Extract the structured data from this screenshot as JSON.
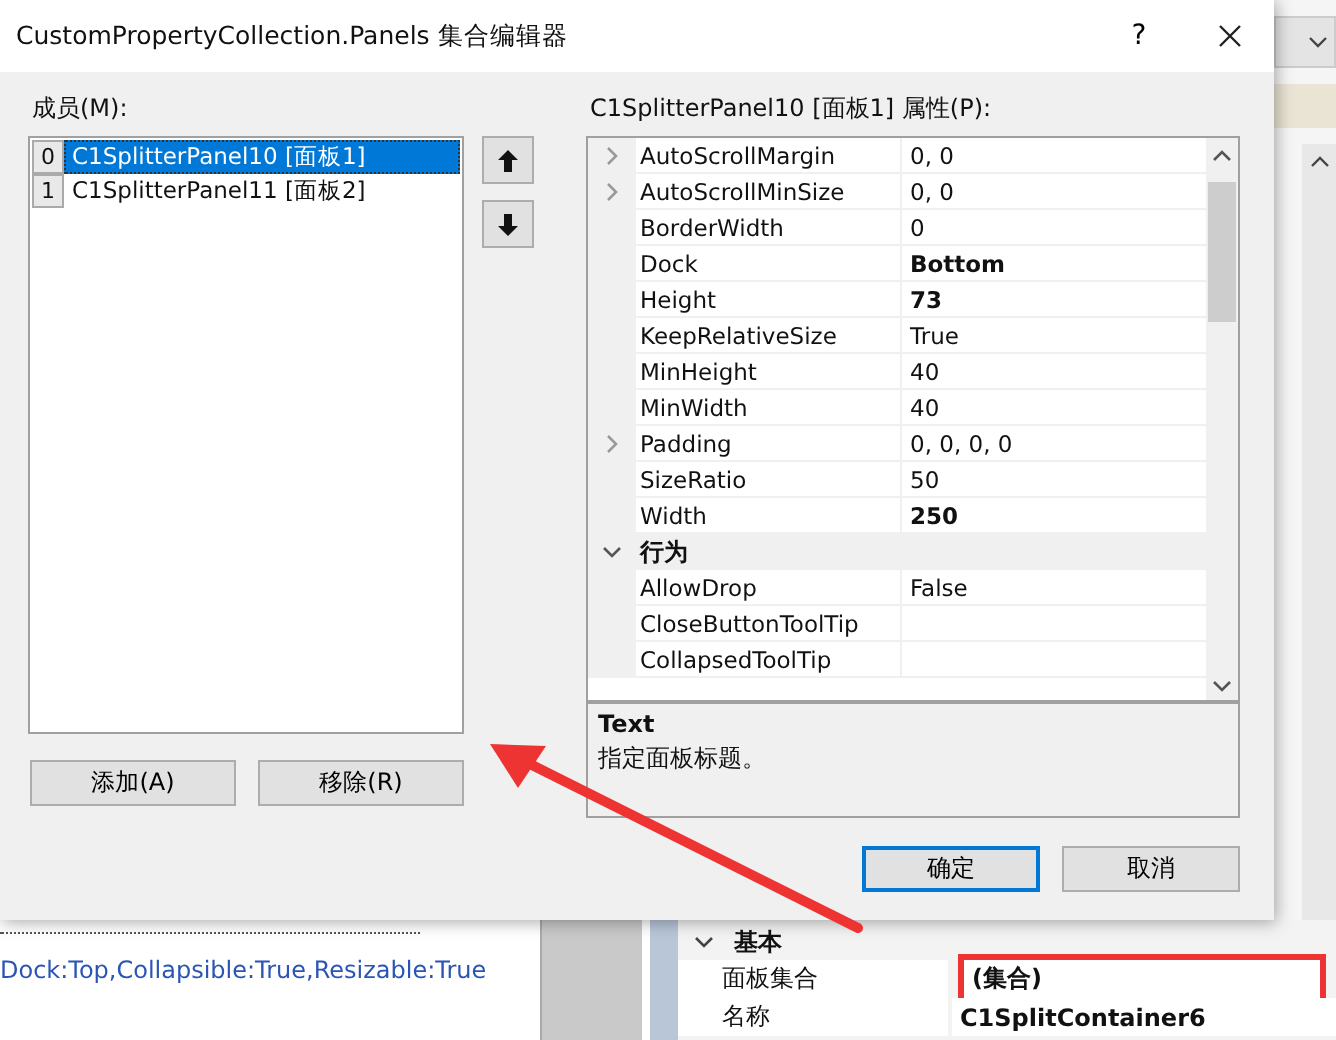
{
  "dialog": {
    "title": "CustomPropertyCollection.Panels 集合编辑器",
    "help_button": "?",
    "members_label": "成员(M):",
    "members": [
      {
        "index": "0",
        "name": "C1SplitterPanel10 [面板1]",
        "selected": true
      },
      {
        "index": "1",
        "name": "C1SplitterPanel11 [面板2]",
        "selected": false
      }
    ],
    "add_button": "添加(A)",
    "remove_button": "移除(R)",
    "properties_label": "C1SplitterPanel10 [面板1] 属性(P):",
    "properties": [
      {
        "kind": "property",
        "name": "AutoScrollMargin",
        "value": "0, 0",
        "expandable": true,
        "bold": false
      },
      {
        "kind": "property",
        "name": "AutoScrollMinSize",
        "value": "0, 0",
        "expandable": true,
        "bold": false
      },
      {
        "kind": "property",
        "name": "BorderWidth",
        "value": "0",
        "expandable": false,
        "bold": false
      },
      {
        "kind": "property",
        "name": "Dock",
        "value": "Bottom",
        "expandable": false,
        "bold": true
      },
      {
        "kind": "property",
        "name": "Height",
        "value": "73",
        "expandable": false,
        "bold": true
      },
      {
        "kind": "property",
        "name": "KeepRelativeSize",
        "value": "True",
        "expandable": false,
        "bold": false
      },
      {
        "kind": "property",
        "name": "MinHeight",
        "value": "40",
        "expandable": false,
        "bold": false
      },
      {
        "kind": "property",
        "name": "MinWidth",
        "value": "40",
        "expandable": false,
        "bold": false
      },
      {
        "kind": "property",
        "name": "Padding",
        "value": "0, 0, 0, 0",
        "expandable": true,
        "bold": false
      },
      {
        "kind": "property",
        "name": "SizeRatio",
        "value": "50",
        "expandable": false,
        "bold": false
      },
      {
        "kind": "property",
        "name": "Width",
        "value": "250",
        "expandable": false,
        "bold": true
      },
      {
        "kind": "category",
        "name": "行为",
        "expanded": true
      },
      {
        "kind": "property",
        "name": "AllowDrop",
        "value": "False",
        "expandable": false,
        "bold": false
      },
      {
        "kind": "property",
        "name": "CloseButtonToolTip",
        "expandable": false
      },
      {
        "kind": "property",
        "name": "CollapsedToolTip",
        "expandable": false
      }
    ],
    "description": {
      "title": "Text",
      "text": "指定面板标题。"
    },
    "ok_button": "确定",
    "cancel_button": "取消"
  },
  "designer": {
    "caption": "Dock:Top,Collapsible:True,Resizable:True"
  },
  "property_grid": {
    "category": {
      "name": "基本",
      "expanded": true
    },
    "rows": [
      {
        "name": "面板集合",
        "value": "(集合)",
        "bold": true,
        "highlighted": true
      },
      {
        "name": "名称",
        "value": "C1SplitContainer6",
        "bold": true,
        "highlighted": false
      }
    ]
  }
}
